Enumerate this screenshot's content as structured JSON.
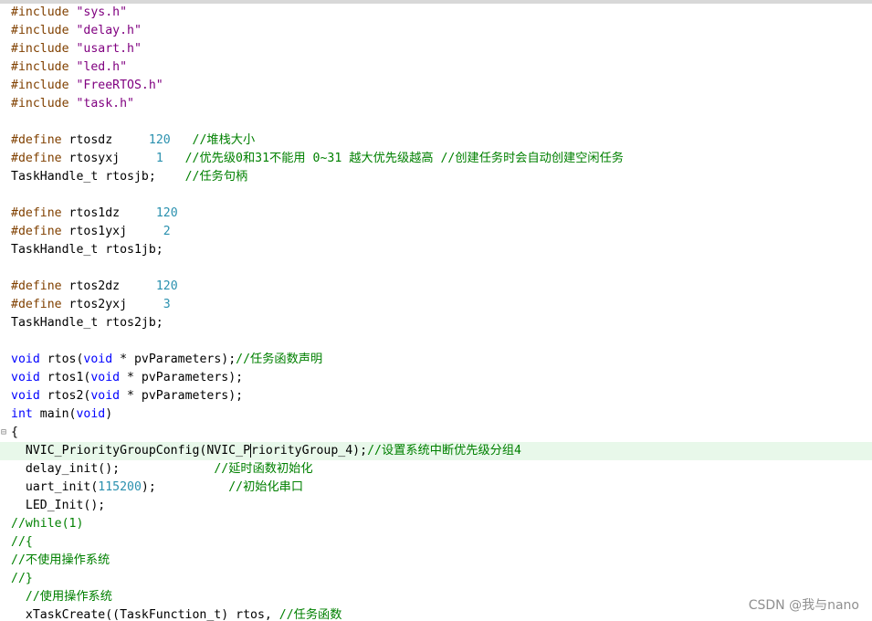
{
  "colors": {
    "keyword": "#0000ff",
    "preprocessor": "#804000",
    "string": "#800080",
    "number": "#2b91af",
    "comment": "#008000",
    "current_line": "#e8f8ea"
  },
  "lines": [
    [
      {
        "t": "#include ",
        "c": "pp"
      },
      {
        "t": "\"sys.h\"",
        "c": "str"
      }
    ],
    [
      {
        "t": "#include ",
        "c": "pp"
      },
      {
        "t": "\"delay.h\"",
        "c": "str"
      }
    ],
    [
      {
        "t": "#include ",
        "c": "pp"
      },
      {
        "t": "\"usart.h\"",
        "c": "str"
      }
    ],
    [
      {
        "t": "#include ",
        "c": "pp"
      },
      {
        "t": "\"led.h\"",
        "c": "str"
      }
    ],
    [
      {
        "t": "#include ",
        "c": "pp"
      },
      {
        "t": "\"FreeRTOS.h\"",
        "c": "str"
      }
    ],
    [
      {
        "t": "#include ",
        "c": "pp"
      },
      {
        "t": "\"task.h\"",
        "c": "str"
      }
    ],
    [],
    [
      {
        "t": "#define ",
        "c": "pp"
      },
      {
        "t": "rtosdz     "
      },
      {
        "t": "120",
        "c": "num"
      },
      {
        "t": "   "
      },
      {
        "t": "//堆栈大小",
        "c": "cmt"
      }
    ],
    [
      {
        "t": "#define ",
        "c": "pp"
      },
      {
        "t": "rtosyxj     "
      },
      {
        "t": "1",
        "c": "num"
      },
      {
        "t": "   "
      },
      {
        "t": "//优先级0和31不能用 0~31 越大优先级越高 //创建任务时会自动创建空闲任务",
        "c": "cmt"
      }
    ],
    [
      {
        "t": "TaskHandle_t rtosjb;    "
      },
      {
        "t": "//任务句柄",
        "c": "cmt"
      }
    ],
    [],
    [
      {
        "t": "#define ",
        "c": "pp"
      },
      {
        "t": "rtos1dz     "
      },
      {
        "t": "120",
        "c": "num"
      }
    ],
    [
      {
        "t": "#define ",
        "c": "pp"
      },
      {
        "t": "rtos1yxj     "
      },
      {
        "t": "2",
        "c": "num"
      }
    ],
    [
      {
        "t": "TaskHandle_t rtos1jb;"
      }
    ],
    [],
    [
      {
        "t": "#define ",
        "c": "pp"
      },
      {
        "t": "rtos2dz     "
      },
      {
        "t": "120",
        "c": "num"
      }
    ],
    [
      {
        "t": "#define ",
        "c": "pp"
      },
      {
        "t": "rtos2yxj     "
      },
      {
        "t": "3",
        "c": "num"
      }
    ],
    [
      {
        "t": "TaskHandle_t rtos2jb;"
      }
    ],
    [],
    [
      {
        "t": "void",
        "c": "kw"
      },
      {
        "t": " rtos("
      },
      {
        "t": "void",
        "c": "kw"
      },
      {
        "t": " * pvParameters);"
      },
      {
        "t": "//任务函数声明",
        "c": "cmt"
      }
    ],
    [
      {
        "t": "void",
        "c": "kw"
      },
      {
        "t": " rtos1("
      },
      {
        "t": "void",
        "c": "kw"
      },
      {
        "t": " * pvParameters);"
      }
    ],
    [
      {
        "t": "void",
        "c": "kw"
      },
      {
        "t": " rtos2("
      },
      {
        "t": "void",
        "c": "kw"
      },
      {
        "t": " * pvParameters);"
      }
    ],
    [
      {
        "t": "int",
        "c": "kw"
      },
      {
        "t": " main("
      },
      {
        "t": "void",
        "c": "kw"
      },
      {
        "t": ")"
      }
    ],
    [
      {
        "t": "{"
      }
    ],
    [
      {
        "t": "  NVIC_PriorityGroupConfig(NVIC_P"
      },
      {
        "caret": true
      },
      {
        "t": "riorityGroup_4);"
      },
      {
        "t": "//设置系统中断优先级分组4",
        "c": "cmt"
      }
    ],
    [
      {
        "t": "  delay_init();             "
      },
      {
        "t": "//延时函数初始化",
        "c": "cmt"
      }
    ],
    [
      {
        "t": "  uart_init("
      },
      {
        "t": "115200",
        "c": "num"
      },
      {
        "t": ");          "
      },
      {
        "t": "//初始化串口",
        "c": "cmt"
      }
    ],
    [
      {
        "t": "  LED_Init();"
      }
    ],
    [
      {
        "t": "//while(1)",
        "c": "cmt"
      }
    ],
    [
      {
        "t": "//{",
        "c": "cmt"
      }
    ],
    [
      {
        "t": "//不使用操作系统",
        "c": "cmt"
      }
    ],
    [
      {
        "t": "//}",
        "c": "cmt"
      }
    ],
    [
      {
        "t": "  "
      },
      {
        "t": "//使用操作系统",
        "c": "cmt"
      }
    ],
    [
      {
        "t": "  xTaskCreate((TaskFunction_t) rtos, "
      },
      {
        "t": "//任务函数",
        "c": "cmt"
      }
    ]
  ],
  "current_line_index": 24,
  "fold_line_index": 23,
  "fold_marker": "⊟",
  "watermark": "CSDN @我与nano"
}
